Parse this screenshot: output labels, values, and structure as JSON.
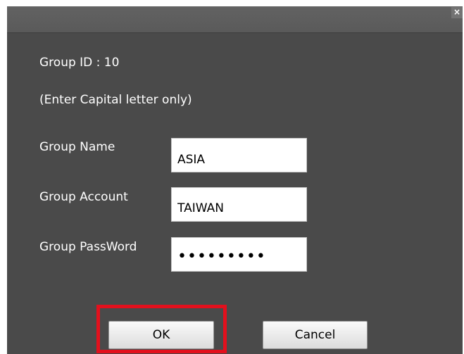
{
  "dialog": {
    "close_label": "×",
    "group_id_text": "Group ID : 10",
    "hint_text": "(Enter Capital letter only)",
    "fields": {
      "name": {
        "label": "Group Name",
        "value": "ASIA"
      },
      "account": {
        "label": "Group Account",
        "value": "TAIWAN"
      },
      "password": {
        "label": "Group PassWord",
        "value": "•••••••••"
      }
    },
    "buttons": {
      "ok": "OK",
      "cancel": "Cancel"
    }
  },
  "colors": {
    "dialog_background": "#4a4a4a",
    "titlebar_background": "#5c5c5c",
    "highlight": "#e3101d"
  }
}
